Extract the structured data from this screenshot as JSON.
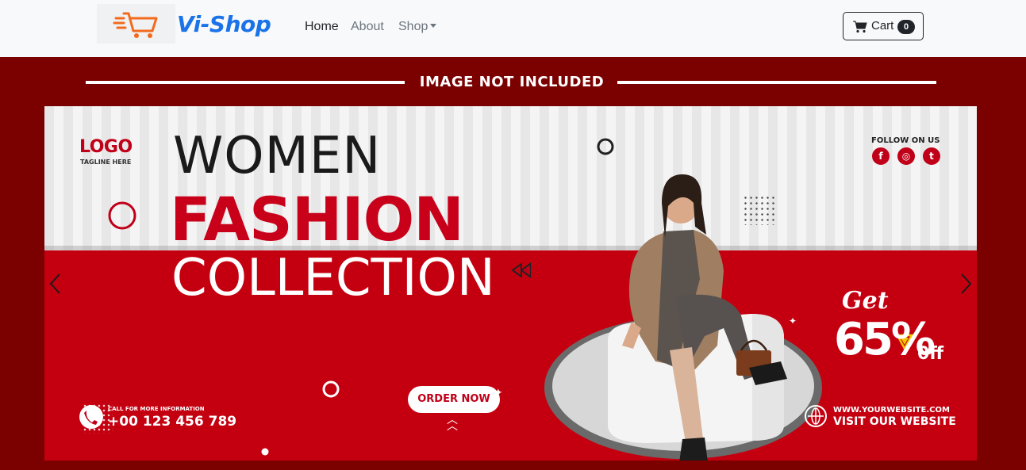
{
  "navbar": {
    "brand": "Vi-Shop",
    "links": {
      "home": "Home",
      "about": "About",
      "shop": "Shop"
    },
    "cart": {
      "label": "Cart",
      "count": "0"
    }
  },
  "hero": {
    "notice": "IMAGE NOT INCLUDED",
    "banner": {
      "logo": "LOGO",
      "tagline": "TAGLINE HERE",
      "title_line1": "WOMEN",
      "title_line2": "FASHION",
      "title_line3": "COLLECTION",
      "follow_label": "FOLLOW ON US",
      "social": [
        "f",
        "◎",
        "t"
      ],
      "offer_get": "Get",
      "offer_percent": "65%",
      "offer_off": "0ff",
      "order_button": "ORDER NOW",
      "call_label": "CALL FOR MORE INFORMATION",
      "phone": "+00 123 456 789",
      "website": "WWW.YOURWEBSITE.COM",
      "visit": "VISIT OUR WEBSITE"
    }
  },
  "colors": {
    "brand_blue": "#1a73e8",
    "cart_orange": "#f26b1d",
    "banner_red": "#c40010",
    "hero_bg": "#7b0000"
  }
}
